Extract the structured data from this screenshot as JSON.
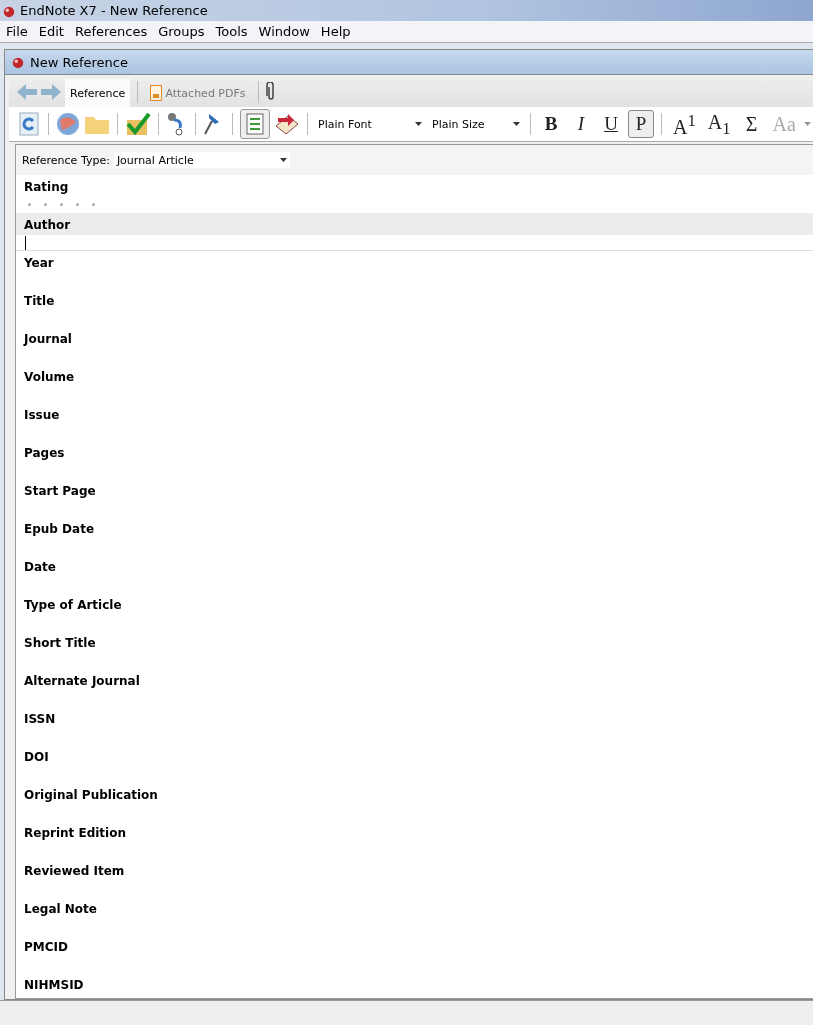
{
  "window": {
    "title": "EndNote X7 - New Reference"
  },
  "menu": [
    "File",
    "Edit",
    "References",
    "Groups",
    "Tools",
    "Window",
    "Help"
  ],
  "document": {
    "title": "New Reference"
  },
  "tabs": [
    {
      "label": "Reference",
      "selected": true
    },
    {
      "label": "Attached PDFs",
      "selected": false
    }
  ],
  "toolbar": {
    "font": "Plain Font",
    "size": "Plain Size",
    "styles": [
      {
        "label": "B",
        "kind": "bold",
        "selected": false
      },
      {
        "label": "I",
        "kind": "italic",
        "selected": false
      },
      {
        "label": "U",
        "kind": "underline",
        "selected": false
      },
      {
        "label": "P",
        "kind": "plain",
        "selected": true
      }
    ],
    "scripts": [
      {
        "label": "A$^{1}$",
        "disabled": false
      },
      {
        "label": "A$_{1}$",
        "disabled": false
      },
      {
        "label": "Σ",
        "disabled": false
      },
      {
        "label": "Aa",
        "disabled": true
      }
    ]
  },
  "reference_type": {
    "label": "Reference Type:",
    "value": "Journal Article"
  },
  "rating": {
    "label": "Rating",
    "stars": 0
  },
  "fields": [
    {
      "label": "Author",
      "focused": true
    },
    {
      "label": "Year",
      "focused": false
    },
    {
      "label": "Title",
      "focused": false
    },
    {
      "label": "Journal",
      "focused": false
    },
    {
      "label": "Volume",
      "focused": false
    },
    {
      "label": "Issue",
      "focused": false
    },
    {
      "label": "Pages",
      "focused": false
    },
    {
      "label": "Start Page",
      "focused": false
    },
    {
      "label": "Epub Date",
      "focused": false
    },
    {
      "label": "Date",
      "focused": false
    },
    {
      "label": "Type of Article",
      "focused": false
    },
    {
      "label": "Short Title",
      "focused": false
    },
    {
      "label": "Alternate Journal",
      "focused": false
    },
    {
      "label": "ISSN",
      "focused": false
    },
    {
      "label": "DOI",
      "focused": false
    },
    {
      "label": "Original Publication",
      "focused": false
    },
    {
      "label": "Reprint Edition",
      "focused": false
    },
    {
      "label": "Reviewed Item",
      "focused": false
    },
    {
      "label": "Legal Note",
      "focused": false
    },
    {
      "label": "PMCID",
      "focused": false
    },
    {
      "label": "NIHMSID",
      "focused": false
    }
  ]
}
